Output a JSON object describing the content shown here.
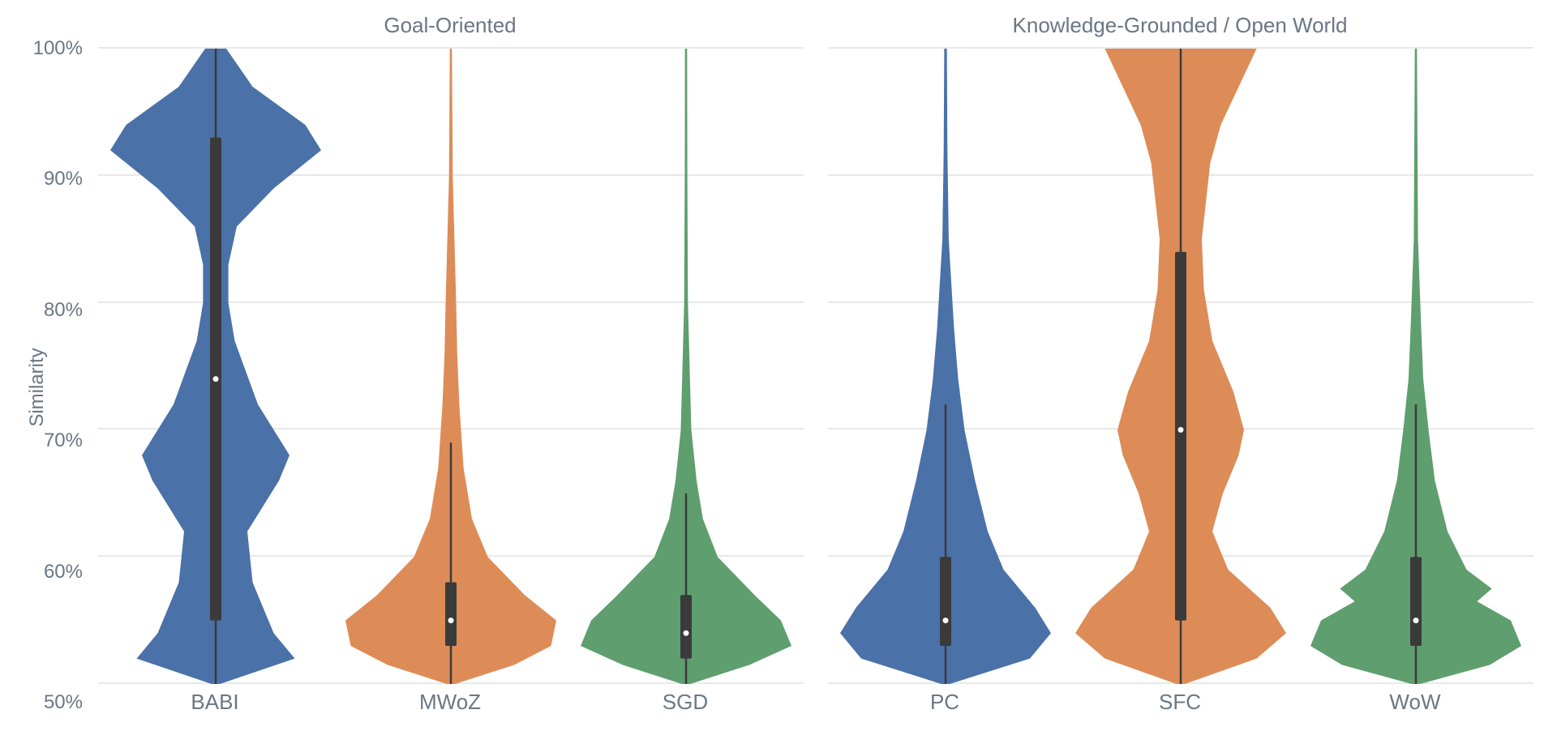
{
  "chart_data": {
    "type": "violin",
    "ylabel": "Similarity",
    "ylim": [
      50,
      100
    ],
    "yticks": [
      50,
      60,
      70,
      80,
      90,
      100
    ],
    "ytick_labels": [
      "50%",
      "60%",
      "70%",
      "80%",
      "90%",
      "100%"
    ],
    "panels": [
      {
        "title": "Goal-Oriented",
        "categories": [
          "BABI",
          "MWoZ",
          "SGD"
        ],
        "colors": [
          "#4a71a8",
          "#dd8c58",
          "#5f9e6e"
        ],
        "series": [
          {
            "name": "BABI",
            "q1": 55,
            "median": 74,
            "q3": 93,
            "whisker_low": 50,
            "whisker_high": 100,
            "density": [
              {
                "y": 50,
                "w": 0.04
              },
              {
                "y": 52,
                "w": 0.75
              },
              {
                "y": 54,
                "w": 0.55
              },
              {
                "y": 58,
                "w": 0.35
              },
              {
                "y": 62,
                "w": 0.3
              },
              {
                "y": 66,
                "w": 0.6
              },
              {
                "y": 68,
                "w": 0.7
              },
              {
                "y": 72,
                "w": 0.4
              },
              {
                "y": 77,
                "w": 0.18
              },
              {
                "y": 80,
                "w": 0.12
              },
              {
                "y": 83,
                "w": 0.12
              },
              {
                "y": 86,
                "w": 0.2
              },
              {
                "y": 89,
                "w": 0.55
              },
              {
                "y": 92,
                "w": 1.0
              },
              {
                "y": 94,
                "w": 0.85
              },
              {
                "y": 97,
                "w": 0.35
              },
              {
                "y": 100,
                "w": 0.1
              }
            ]
          },
          {
            "name": "MWoZ",
            "q1": 53,
            "median": 55,
            "q3": 58,
            "whisker_low": 50,
            "whisker_high": 69,
            "density": [
              {
                "y": 50,
                "w": 0.04
              },
              {
                "y": 51.5,
                "w": 0.6
              },
              {
                "y": 53,
                "w": 0.95
              },
              {
                "y": 55,
                "w": 1.0
              },
              {
                "y": 57,
                "w": 0.7
              },
              {
                "y": 60,
                "w": 0.35
              },
              {
                "y": 63,
                "w": 0.2
              },
              {
                "y": 67,
                "w": 0.12
              },
              {
                "y": 72,
                "w": 0.08
              },
              {
                "y": 76,
                "w": 0.06
              },
              {
                "y": 80,
                "w": 0.05
              },
              {
                "y": 90,
                "w": 0.018
              },
              {
                "y": 100,
                "w": 0.01
              }
            ]
          },
          {
            "name": "SGD",
            "q1": 52,
            "median": 54,
            "q3": 57,
            "whisker_low": 50,
            "whisker_high": 65,
            "density": [
              {
                "y": 50,
                "w": 0.04
              },
              {
                "y": 51.5,
                "w": 0.6
              },
              {
                "y": 53,
                "w": 1.0
              },
              {
                "y": 55,
                "w": 0.9
              },
              {
                "y": 57,
                "w": 0.65
              },
              {
                "y": 60,
                "w": 0.3
              },
              {
                "y": 63,
                "w": 0.16
              },
              {
                "y": 66,
                "w": 0.1
              },
              {
                "y": 70,
                "w": 0.05
              },
              {
                "y": 80,
                "w": 0.018
              },
              {
                "y": 90,
                "w": 0.012
              },
              {
                "y": 100,
                "w": 0.01
              }
            ]
          }
        ]
      },
      {
        "title": "Knowledge-Grounded / Open World",
        "categories": [
          "PC",
          "SFC",
          "WoW"
        ],
        "colors": [
          "#4a71a8",
          "#dd8c58",
          "#5f9e6e"
        ],
        "series": [
          {
            "name": "PC",
            "q1": 53,
            "median": 55,
            "q3": 60,
            "whisker_low": 50,
            "whisker_high": 72,
            "density": [
              {
                "y": 50,
                "w": 0.04
              },
              {
                "y": 52,
                "w": 0.8
              },
              {
                "y": 54,
                "w": 1.0
              },
              {
                "y": 56,
                "w": 0.85
              },
              {
                "y": 59,
                "w": 0.55
              },
              {
                "y": 62,
                "w": 0.4
              },
              {
                "y": 66,
                "w": 0.28
              },
              {
                "y": 70,
                "w": 0.18
              },
              {
                "y": 74,
                "w": 0.12
              },
              {
                "y": 78,
                "w": 0.08
              },
              {
                "y": 85,
                "w": 0.03
              },
              {
                "y": 92,
                "w": 0.018
              },
              {
                "y": 100,
                "w": 0.012
              }
            ]
          },
          {
            "name": "SFC",
            "q1": 55,
            "median": 70,
            "q3": 84,
            "whisker_low": 50,
            "whisker_high": 100,
            "density": [
              {
                "y": 50,
                "w": 0.04
              },
              {
                "y": 52,
                "w": 0.72
              },
              {
                "y": 54,
                "w": 1.0
              },
              {
                "y": 56,
                "w": 0.85
              },
              {
                "y": 59,
                "w": 0.45
              },
              {
                "y": 62,
                "w": 0.3
              },
              {
                "y": 65,
                "w": 0.4
              },
              {
                "y": 68,
                "w": 0.55
              },
              {
                "y": 70,
                "w": 0.6
              },
              {
                "y": 73,
                "w": 0.5
              },
              {
                "y": 77,
                "w": 0.3
              },
              {
                "y": 81,
                "w": 0.22
              },
              {
                "y": 85,
                "w": 0.2
              },
              {
                "y": 88,
                "w": 0.24
              },
              {
                "y": 91,
                "w": 0.28
              },
              {
                "y": 94,
                "w": 0.38
              },
              {
                "y": 97,
                "w": 0.55
              },
              {
                "y": 100,
                "w": 0.72
              }
            ]
          },
          {
            "name": "WoW",
            "q1": 53,
            "median": 55,
            "q3": 60,
            "whisker_low": 50,
            "whisker_high": 72,
            "density": [
              {
                "y": 50,
                "w": 0.04
              },
              {
                "y": 51.5,
                "w": 0.7
              },
              {
                "y": 53,
                "w": 1.0
              },
              {
                "y": 55,
                "w": 0.9
              },
              {
                "y": 56.5,
                "w": 0.58
              },
              {
                "y": 57.5,
                "w": 0.72
              },
              {
                "y": 59,
                "w": 0.48
              },
              {
                "y": 62,
                "w": 0.3
              },
              {
                "y": 66,
                "w": 0.18
              },
              {
                "y": 70,
                "w": 0.12
              },
              {
                "y": 74,
                "w": 0.07
              },
              {
                "y": 78,
                "w": 0.05
              },
              {
                "y": 85,
                "w": 0.02
              },
              {
                "y": 100,
                "w": 0.01
              }
            ]
          }
        ]
      }
    ]
  }
}
